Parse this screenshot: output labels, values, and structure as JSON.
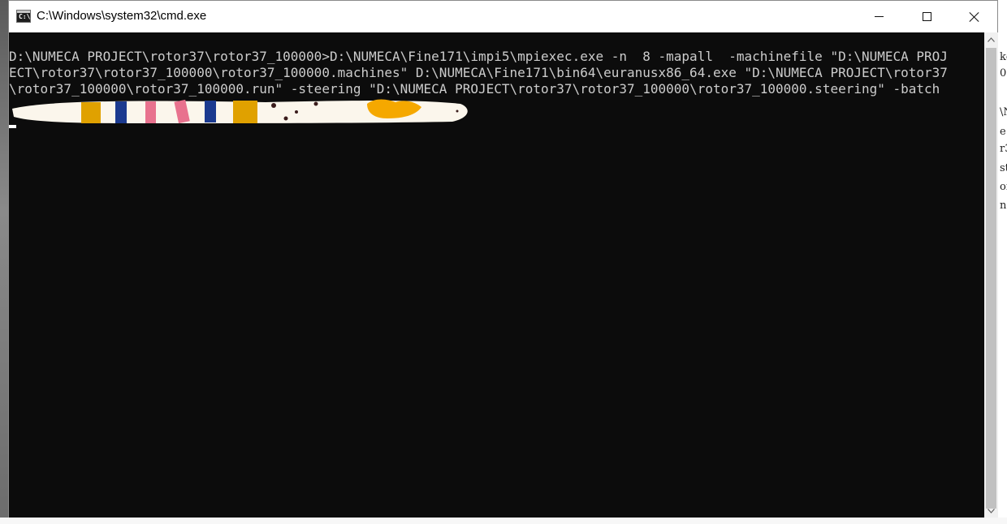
{
  "window": {
    "title": "C:\\Windows\\system32\\cmd.exe",
    "icon_label": "C:\\."
  },
  "controls": {
    "minimize": "minimize",
    "maximize": "maximize",
    "close": "close"
  },
  "console": {
    "lines": [
      "D:\\NUMECA PROJECT\\rotor37\\rotor37_100000>D:\\NUMECA\\Fine171\\impi5\\mpiexec.exe -n  8 -mapall  -machinefile \"D:\\NUMECA PROJ",
      "ECT\\rotor37\\rotor37_100000\\rotor37_100000.machines\" D:\\NUMECA\\Fine171\\bin64\\euranusx86_64.exe \"D:\\NUMECA PROJECT\\rotor37",
      "\\rotor37_100000\\rotor37_100000.run\" -steering \"D:\\NUMECA PROJECT\\rotor37\\rotor37_100000\\rotor37_100000.steering\" -batch"
    ]
  },
  "background_right_fragments": [
    "ke",
    "0",
    "\\N",
    "e",
    "r3",
    "st",
    "of",
    "ng"
  ],
  "colors": {
    "console_bg": "#0c0c0c",
    "console_text": "#cccccc",
    "redaction_stripes": [
      "#e0a100",
      "#1b3a8f",
      "#e8728e",
      "#f5a800"
    ]
  }
}
